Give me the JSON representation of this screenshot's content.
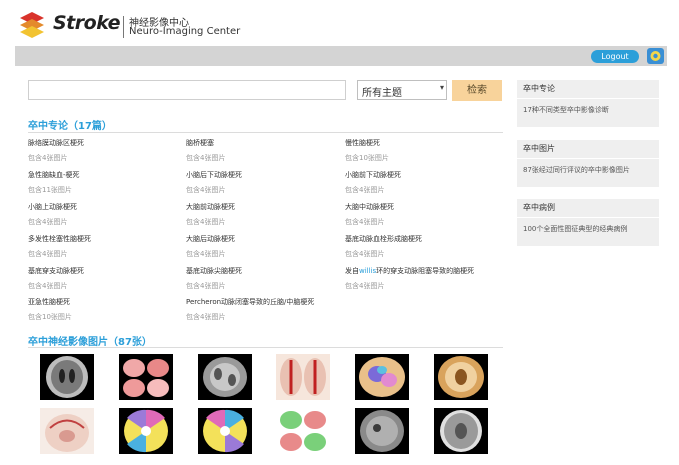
{
  "header": {
    "brand": "Stroke",
    "brand_cn": "神经影像中心",
    "brand_en": "Neuro-Imaging Center"
  },
  "topbar": {
    "logout_label": "Logout",
    "settings_icon": "settings-icon"
  },
  "search": {
    "value": "",
    "select_value": "所有主题",
    "button_label": "检索"
  },
  "topics": {
    "title": "卒中专论（17篇）",
    "items": [
      {
        "name": "脉络膜动脉区梗死",
        "count": "包含4张图片"
      },
      {
        "name": "脑桥梗塞",
        "count": "包含4张图片"
      },
      {
        "name": "慢性脑梗死",
        "count": "包含10张图片"
      },
      {
        "name": "急性脑缺血-梗死",
        "count": "包含11张图片"
      },
      {
        "name": "小脑后下动脉梗死",
        "count": "包含4张图片"
      },
      {
        "name": "小脑前下动脉梗死",
        "count": "包含4张图片"
      },
      {
        "name": "小脑上动脉梗死",
        "count": "包含4张图片"
      },
      {
        "name": "大脑前动脉梗死",
        "count": "包含4张图片"
      },
      {
        "name": "大脑中动脉梗死",
        "count": "包含4张图片"
      },
      {
        "name": "多发性栓塞性脑梗死",
        "count": "包含4张图片"
      },
      {
        "name": "大脑后动脉梗死",
        "count": "包含4张图片"
      },
      {
        "name": "基底动脉血栓形成脑梗死",
        "count": "包含4张图片"
      },
      {
        "name": "基底穿支动脉梗死",
        "count": "包含4张图片"
      },
      {
        "name": "基底动脉尖脑梗死",
        "count": "包含4张图片"
      },
      {
        "name_pre": "发自",
        "name_hl": "willis",
        "name_post": "环的穿支动脉阻塞导致的脑梗死",
        "count": "包含4张图片"
      },
      {
        "name": "亚急性脑梗死",
        "count": "包含10张图片"
      },
      {
        "name": "Percheron动脉闭塞导致的丘脑/中脑梗死",
        "count": "包含4张图片"
      }
    ]
  },
  "images": {
    "title": "卒中神经影像图片（87张）",
    "thumbs": [
      "ct-axial",
      "brain-lobes-color",
      "mri-flair",
      "vessel-anatomy",
      "brainstem-color",
      "pathology-slice",
      "brain-coronal-section",
      "brainstem-territory",
      "brainstem-territory-2",
      "brain-lobes-color-2",
      "mri-dwi",
      "ct-axial-2"
    ]
  },
  "sidebar": [
    {
      "title": "卒中专论",
      "body": "17种不同类型卒中影像诊断"
    },
    {
      "title": "卒中图片",
      "body": "87张经过同行评议的卒中影像图片"
    },
    {
      "title": "卒中病例",
      "body": "100个全面性图征典型的经典病例"
    }
  ],
  "colors": {
    "accent": "#2c9fd9",
    "search_button": "#f8d39b",
    "topbar": "#d4d4d4",
    "sidebar_bg": "#efefef"
  }
}
